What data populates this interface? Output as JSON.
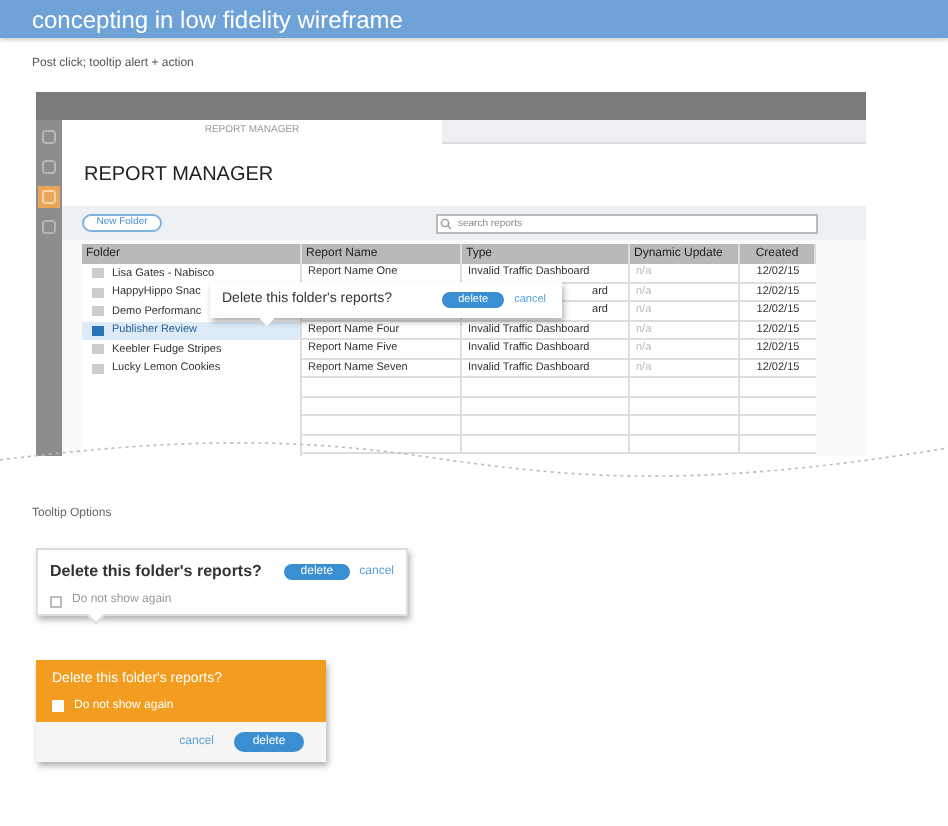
{
  "header": {
    "title": "concepting in low fidelity wireframe"
  },
  "caption": "Post click; tooltip alert + action",
  "mockup": {
    "tab": "REPORT MANAGER",
    "title": "REPORT MANAGER",
    "sidebar_icons": [
      {
        "selected": false
      },
      {
        "selected": false
      },
      {
        "selected": true
      },
      {
        "selected": false
      }
    ],
    "new_folder": "New Folder",
    "search": {
      "placeholder": "search reports"
    },
    "columns": [
      "Folder",
      "Report Name",
      "Type",
      "Dynamic Update",
      "Created"
    ],
    "folders": [
      {
        "name": "Lisa Gates - Nabisco",
        "selected": false
      },
      {
        "name": "HappyHippo Snac",
        "selected": false
      },
      {
        "name": "Demo Performanc",
        "selected": false
      },
      {
        "name": "Publisher Review",
        "selected": true
      },
      {
        "name": "Keebler Fudge Stripes",
        "selected": false
      },
      {
        "name": "Lucky Lemon Cookies",
        "selected": false
      }
    ],
    "rows": [
      {
        "report_name": "Report Name One",
        "type": "Invalid Traffic Dashboard",
        "dynamic_update": "n/a",
        "created": "12/02/15"
      },
      {
        "type": "ard",
        "type_cut": true,
        "dynamic_update": "n/a",
        "created": "12/02/15"
      },
      {
        "type": "ard",
        "type_cut": true,
        "dynamic_update": "n/a",
        "created": "12/02/15"
      },
      {
        "report_name": "Report Name Four",
        "type": "Invalid Traffic Dashboard",
        "dynamic_update": "n/a",
        "created": "12/02/15"
      },
      {
        "report_name": "Report Name Five",
        "type": "Invalid Traffic Dashboard",
        "dynamic_update": "n/a",
        "created": "12/02/15"
      },
      {
        "report_name": "Report Name Seven",
        "type": "Invalid Traffic Dashboard",
        "dynamic_update": "n/a",
        "created": "12/02/15"
      }
    ],
    "tooltip": {
      "question": "Delete this folder's reports?",
      "delete": "delete",
      "cancel": "cancel"
    }
  },
  "options_title": "Tooltip Options",
  "options": [
    {
      "kind": "plain",
      "question": "Delete this folder's reports?",
      "delete": "delete",
      "cancel": "cancel",
      "checkbox": {
        "label": "Do not show again",
        "checked": false
      }
    },
    {
      "kind": "orange",
      "question": "Delete this folder's reports?",
      "delete": "delete",
      "cancel": "cancel",
      "checkbox": {
        "label": "Do not show again",
        "checked": false
      }
    }
  ]
}
